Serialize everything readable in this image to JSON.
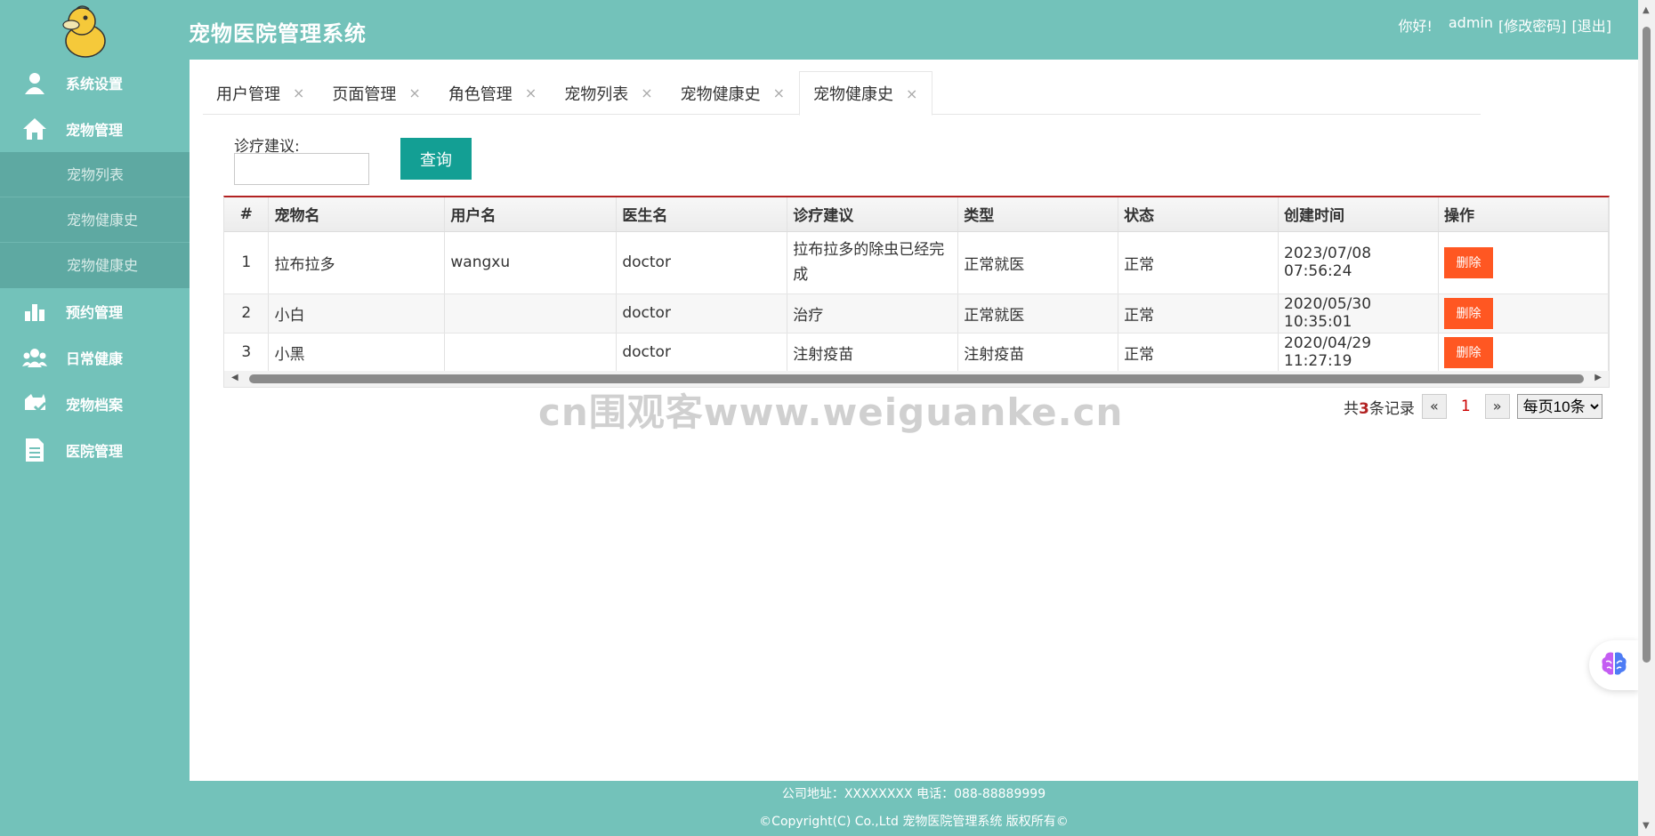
{
  "app": {
    "title": "宠物医院管理系统"
  },
  "user_bar": {
    "greeting": "你好!",
    "username": "admin",
    "change_password": "[修改密码]",
    "logout": "[退出]"
  },
  "sidebar": {
    "items": [
      {
        "label": "系统设置",
        "icon": "user-icon"
      },
      {
        "label": "宠物管理",
        "icon": "home-icon",
        "children": [
          {
            "label": "宠物列表"
          },
          {
            "label": "宠物健康史"
          },
          {
            "label": "宠物健康史"
          }
        ]
      },
      {
        "label": "预约管理",
        "icon": "bar-chart-icon"
      },
      {
        "label": "日常健康",
        "icon": "users-icon"
      },
      {
        "label": "宠物档案",
        "icon": "pet-check-icon"
      },
      {
        "label": "医院管理",
        "icon": "document-icon"
      }
    ]
  },
  "tabs": [
    {
      "label": "用户管理",
      "close": "×"
    },
    {
      "label": "页面管理",
      "close": "×"
    },
    {
      "label": "角色管理",
      "close": "×"
    },
    {
      "label": "宠物列表",
      "close": "×"
    },
    {
      "label": "宠物健康史",
      "close": "×"
    },
    {
      "label": "宠物健康史",
      "close": "×",
      "active": true
    }
  ],
  "search": {
    "label": "诊疗建议:",
    "value": "",
    "button": "查询"
  },
  "table": {
    "columns": [
      "#",
      "宠物名",
      "用户名",
      "医生名",
      "诊疗建议",
      "类型",
      "状态",
      "创建时间",
      "操作"
    ],
    "rows": [
      {
        "no": "1",
        "pet": "拉布拉多",
        "user": "wangxu",
        "doctor": "doctor",
        "advice": "拉布拉多的除虫已经完成",
        "type": "正常就医",
        "status": "正常",
        "created": "2023/07/08 07:56:24",
        "action": "删除"
      },
      {
        "no": "2",
        "pet": "小白",
        "user": "",
        "doctor": "doctor",
        "advice": "治疗",
        "type": "正常就医",
        "status": "正常",
        "created": "2020/05/30 10:35:01",
        "action": "删除"
      },
      {
        "no": "3",
        "pet": "小黑",
        "user": "",
        "doctor": "doctor",
        "advice": "注射疫苗",
        "type": "注射疫苗",
        "status": "正常",
        "created": "2020/04/29 11:27:19",
        "action": "删除"
      }
    ]
  },
  "pager": {
    "prefix": "共",
    "count": "3",
    "suffix": "条记录",
    "prev": "«",
    "current": "1",
    "next": "»",
    "per_page": "每页10条"
  },
  "watermark": "cn围观客www.weiguanke.cn",
  "footer": {
    "address": "公司地址：XXXXXXXX 电话：088-88889999",
    "copyright": "©Copyright(C) Co.,Ltd 宠物医院管理系统 版权所有©"
  },
  "colors": {
    "primary": "#73c2ba",
    "button": "#139f94",
    "delete": "#ff5722",
    "accent_line": "#b22222"
  }
}
